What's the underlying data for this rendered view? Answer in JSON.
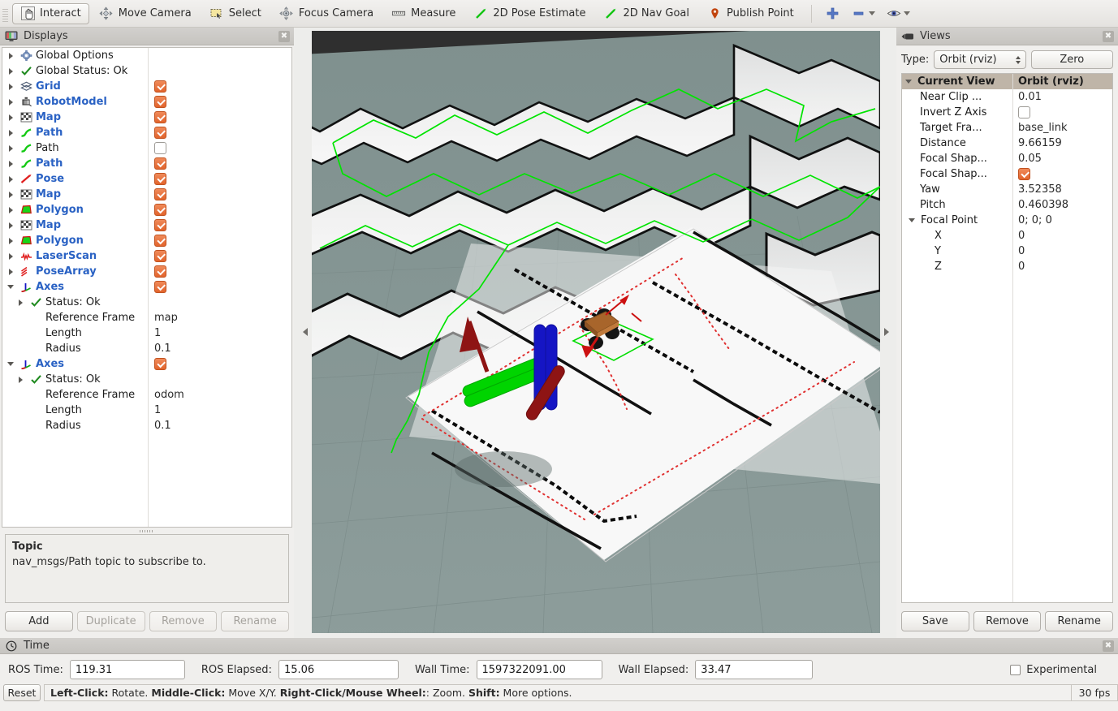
{
  "toolbar": {
    "buttons": [
      {
        "label": "Interact",
        "icon": "hand-cursor-icon",
        "active": true
      },
      {
        "label": "Move Camera",
        "icon": "move-camera-icon",
        "active": false
      },
      {
        "label": "Select",
        "icon": "select-rect-icon",
        "active": false
      },
      {
        "label": "Focus Camera",
        "icon": "focus-camera-icon",
        "active": false
      },
      {
        "label": "Measure",
        "icon": "ruler-icon",
        "active": false
      },
      {
        "label": "2D Pose Estimate",
        "icon": "pose-arrow-icon",
        "active": false
      },
      {
        "label": "2D Nav Goal",
        "icon": "nav-goal-arrow-icon",
        "active": false
      },
      {
        "label": "Publish Point",
        "icon": "map-pin-icon",
        "active": false
      }
    ],
    "add_tool_icon": "plus-icon",
    "remove_tool_icon": "minus-icon",
    "visibility_icon": "eye-icon"
  },
  "displays": {
    "title": "Displays",
    "close_icon": "close-icon",
    "tree": [
      {
        "indent": 0,
        "arrow": "closed",
        "icon": "gear-icon",
        "label": "Global Options",
        "bold": false,
        "check": null
      },
      {
        "indent": 0,
        "arrow": "closed",
        "icon": "check-icon",
        "label": "Global Status: Ok",
        "bold": false,
        "check": null
      },
      {
        "indent": 0,
        "arrow": "closed",
        "icon": "grid-icon",
        "label": "Grid",
        "bold": true,
        "check": "on"
      },
      {
        "indent": 0,
        "arrow": "closed",
        "icon": "robot-icon",
        "label": "RobotModel",
        "bold": true,
        "check": "on"
      },
      {
        "indent": 0,
        "arrow": "closed",
        "icon": "map-icon",
        "label": "Map",
        "bold": true,
        "check": "on"
      },
      {
        "indent": 0,
        "arrow": "closed",
        "icon": "path-icon",
        "label": "Path",
        "bold": true,
        "check": "on"
      },
      {
        "indent": 0,
        "arrow": "closed",
        "icon": "path-icon",
        "label": "Path",
        "bold": false,
        "check": "off"
      },
      {
        "indent": 0,
        "arrow": "closed",
        "icon": "path-icon",
        "label": "Path",
        "bold": true,
        "check": "on"
      },
      {
        "indent": 0,
        "arrow": "closed",
        "icon": "pose-icon",
        "label": "Pose",
        "bold": true,
        "check": "on"
      },
      {
        "indent": 0,
        "arrow": "closed",
        "icon": "map-icon",
        "label": "Map",
        "bold": true,
        "check": "on"
      },
      {
        "indent": 0,
        "arrow": "closed",
        "icon": "polygon-icon",
        "label": "Polygon",
        "bold": true,
        "check": "on"
      },
      {
        "indent": 0,
        "arrow": "closed",
        "icon": "map-icon",
        "label": "Map",
        "bold": true,
        "check": "on"
      },
      {
        "indent": 0,
        "arrow": "closed",
        "icon": "polygon-icon",
        "label": "Polygon",
        "bold": true,
        "check": "on"
      },
      {
        "indent": 0,
        "arrow": "closed",
        "icon": "laserscan-icon",
        "label": "LaserScan",
        "bold": true,
        "check": "on"
      },
      {
        "indent": 0,
        "arrow": "closed",
        "icon": "posearray-icon",
        "label": "PoseArray",
        "bold": true,
        "check": "on"
      },
      {
        "indent": 0,
        "arrow": "open",
        "icon": "axes-icon",
        "label": "Axes",
        "bold": true,
        "check": "on"
      },
      {
        "indent": 1,
        "arrow": "closed",
        "icon": "check-icon",
        "label": "Status: Ok",
        "bold": false,
        "check": null
      },
      {
        "indent": 1,
        "arrow": "none",
        "icon": "none",
        "label": "Reference Frame",
        "bold": false,
        "check": null,
        "value": "map"
      },
      {
        "indent": 1,
        "arrow": "none",
        "icon": "none",
        "label": "Length",
        "bold": false,
        "check": null,
        "value": "1"
      },
      {
        "indent": 1,
        "arrow": "none",
        "icon": "none",
        "label": "Radius",
        "bold": false,
        "check": null,
        "value": "0.1"
      },
      {
        "indent": 0,
        "arrow": "open",
        "icon": "axes-icon",
        "label": "Axes",
        "bold": true,
        "check": "on"
      },
      {
        "indent": 1,
        "arrow": "closed",
        "icon": "check-icon",
        "label": "Status: Ok",
        "bold": false,
        "check": null
      },
      {
        "indent": 1,
        "arrow": "none",
        "icon": "none",
        "label": "Reference Frame",
        "bold": false,
        "check": null,
        "value": "odom"
      },
      {
        "indent": 1,
        "arrow": "none",
        "icon": "none",
        "label": "Length",
        "bold": false,
        "check": null,
        "value": "1"
      },
      {
        "indent": 1,
        "arrow": "none",
        "icon": "none",
        "label": "Radius",
        "bold": false,
        "check": null,
        "value": "0.1"
      }
    ],
    "help": {
      "title": "Topic",
      "text": "nav_msgs/Path topic to subscribe to."
    },
    "buttons": [
      {
        "label": "Add",
        "enabled": true
      },
      {
        "label": "Duplicate",
        "enabled": false
      },
      {
        "label": "Remove",
        "enabled": false
      },
      {
        "label": "Rename",
        "enabled": false
      }
    ]
  },
  "views": {
    "title": "Views",
    "close_icon": "close-icon",
    "camera_icon": "camera-icon",
    "type_label": "Type:",
    "type_value": "Orbit (rviz)",
    "zero_label": "Zero",
    "header": {
      "name": "Current View",
      "value": "Orbit (rviz)"
    },
    "rows": [
      {
        "name": "Near Clip ...",
        "value": "0.01",
        "level": 1,
        "kind": "text"
      },
      {
        "name": "Invert Z Axis",
        "value": "",
        "level": 1,
        "kind": "checkbox-off"
      },
      {
        "name": "Target Fra...",
        "value": "base_link",
        "level": 1,
        "kind": "text"
      },
      {
        "name": "Distance",
        "value": "9.66159",
        "level": 1,
        "kind": "text"
      },
      {
        "name": "Focal Shap...",
        "value": "0.05",
        "level": 1,
        "kind": "text"
      },
      {
        "name": "Focal Shap...",
        "value": "",
        "level": 1,
        "kind": "checkbox-on"
      },
      {
        "name": "Yaw",
        "value": "3.52358",
        "level": 1,
        "kind": "text"
      },
      {
        "name": "Pitch",
        "value": "0.460398",
        "level": 1,
        "kind": "text"
      },
      {
        "name": "Focal Point",
        "value": "0; 0; 0",
        "level": 1,
        "kind": "text",
        "arrow": "open"
      },
      {
        "name": "X",
        "value": "0",
        "level": 2,
        "kind": "text"
      },
      {
        "name": "Y",
        "value": "0",
        "level": 2,
        "kind": "text"
      },
      {
        "name": "Z",
        "value": "0",
        "level": 2,
        "kind": "text"
      }
    ],
    "buttons": [
      {
        "label": "Save"
      },
      {
        "label": "Remove"
      },
      {
        "label": "Rename"
      }
    ]
  },
  "time": {
    "title": "Time",
    "clock_icon": "clock-icon",
    "close_icon": "close-icon",
    "fields": [
      {
        "label": "ROS Time:",
        "value": "119.31"
      },
      {
        "label": "ROS Elapsed:",
        "value": "15.06"
      },
      {
        "label": "Wall Time:",
        "value": "1597322091.00"
      },
      {
        "label": "Wall Elapsed:",
        "value": "33.47"
      }
    ],
    "experimental_label": "Experimental",
    "experimental_checked": false
  },
  "statusbar": {
    "reset_label": "Reset",
    "hints": [
      {
        "bold": "Left-Click:",
        "text": " Rotate. "
      },
      {
        "bold": "Middle-Click:",
        "text": " Move X/Y. "
      },
      {
        "bold": "Right-Click/Mouse Wheel:",
        "text": ": Zoom. "
      },
      {
        "bold": "Shift:",
        "text": " More options."
      }
    ],
    "fps": "30 fps"
  },
  "viewport": {
    "background_color": "#879795",
    "sky_color": "#2f2f2f",
    "grid_color": "#7d8d8b",
    "map_free_color": "#f2f2f2",
    "map_occupied_color": "#111111",
    "path_color": "#00e000",
    "posearray_color": "#dd2222",
    "polygon_color": "#00dd00",
    "axis_x_color": "#bb1111",
    "axis_y_color": "#00dd00",
    "axis_z_color": "#1111cc",
    "robot_body_color": "#a8652b",
    "robot_wheel_color": "#141414",
    "cursor_icon": "arrow-cursor"
  }
}
